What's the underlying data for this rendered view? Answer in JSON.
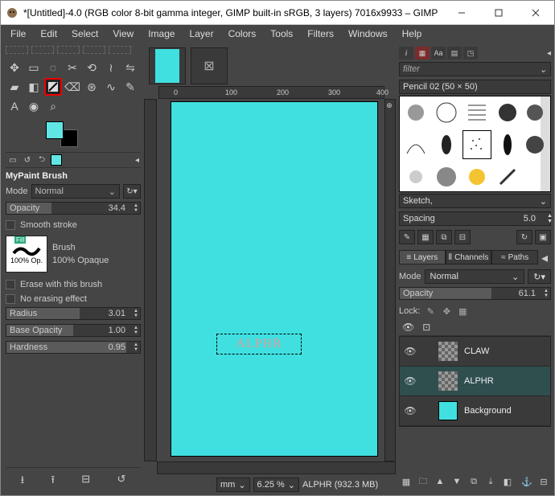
{
  "titlebar": {
    "title": "*[Untitled]-4.0 (RGB color 8-bit gamma integer, GIMP built-in sRGB, 3 layers) 7016x9933 – GIMP"
  },
  "menubar": [
    "File",
    "Edit",
    "Select",
    "View",
    "Image",
    "Layer",
    "Colors",
    "Tools",
    "Filters",
    "Windows",
    "Help"
  ],
  "left": {
    "section_title": "MyPaint Brush",
    "mode_label": "Mode",
    "mode_value": "Normal",
    "opacity_label": "Opacity",
    "opacity_value": "34.4",
    "smooth_stroke": "Smooth stroke",
    "brush_label": "Brush",
    "brush_op_box": "100% Op.",
    "brush_op_text": "100% Opaque",
    "erase_checkbox": "Erase with this brush",
    "no_erase_checkbox": "No erasing effect",
    "radius_label": "Radius",
    "radius_value": "3.01",
    "base_opacity_label": "Base Opacity",
    "base_opacity_value": "1.00",
    "hardness_label": "Hardness",
    "hardness_value": "0.95",
    "fill_tag": "Fill"
  },
  "canvas": {
    "ruler_marks": [
      "0",
      "100",
      "200",
      "300",
      "400"
    ],
    "sel_text": "ALPHR"
  },
  "statusbar": {
    "unit": "mm",
    "zoom": "6.25 %",
    "info": "ALPHR (932.3 MB)"
  },
  "right": {
    "filter_placeholder": "filter",
    "brush_name": "Pencil 02 (50 × 50)",
    "preset": "Sketch,",
    "spacing_label": "Spacing",
    "spacing_value": "5.0",
    "tabs": {
      "layers": "Layers",
      "channels": "Channels",
      "paths": "Paths"
    },
    "layer_mode_label": "Mode",
    "layer_mode_value": "Normal",
    "layer_opacity_label": "Opacity",
    "layer_opacity_value": "61.1",
    "lock_label": "Lock:",
    "layers": [
      {
        "name": "CLAW",
        "thumb": "checker",
        "selected": false
      },
      {
        "name": "ALPHR",
        "thumb": "checker",
        "selected": true
      },
      {
        "name": "Background",
        "thumb": "bg",
        "selected": false
      }
    ]
  }
}
